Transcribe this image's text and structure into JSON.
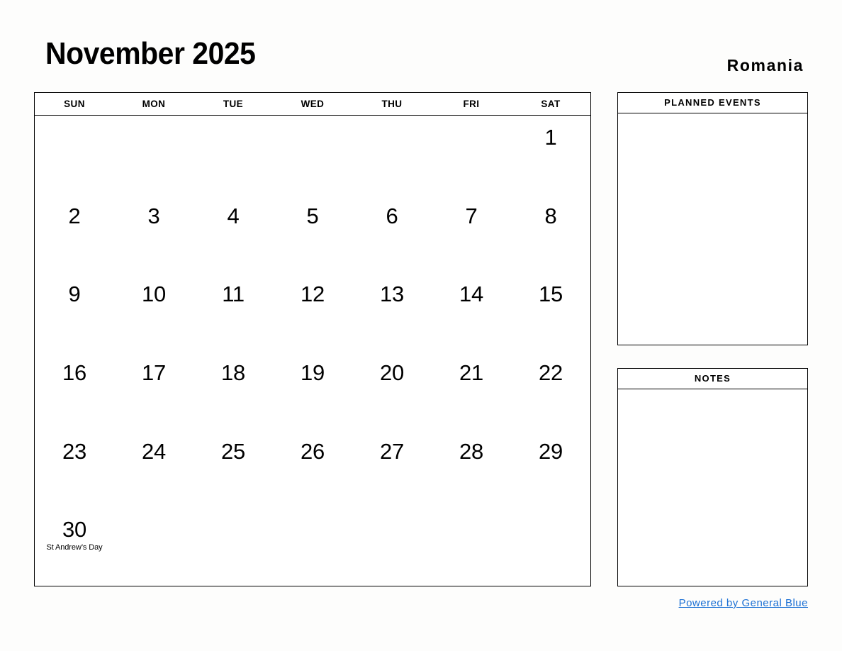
{
  "header": {
    "month_title": "November 2025",
    "country": "Romania"
  },
  "calendar": {
    "weekdays": [
      "SUN",
      "MON",
      "TUE",
      "WED",
      "THU",
      "FRI",
      "SAT"
    ],
    "weeks": [
      [
        {
          "day": "",
          "event": ""
        },
        {
          "day": "",
          "event": ""
        },
        {
          "day": "",
          "event": ""
        },
        {
          "day": "",
          "event": ""
        },
        {
          "day": "",
          "event": ""
        },
        {
          "day": "",
          "event": ""
        },
        {
          "day": "1",
          "event": ""
        }
      ],
      [
        {
          "day": "2",
          "event": ""
        },
        {
          "day": "3",
          "event": ""
        },
        {
          "day": "4",
          "event": ""
        },
        {
          "day": "5",
          "event": ""
        },
        {
          "day": "6",
          "event": ""
        },
        {
          "day": "7",
          "event": ""
        },
        {
          "day": "8",
          "event": ""
        }
      ],
      [
        {
          "day": "9",
          "event": ""
        },
        {
          "day": "10",
          "event": ""
        },
        {
          "day": "11",
          "event": ""
        },
        {
          "day": "12",
          "event": ""
        },
        {
          "day": "13",
          "event": ""
        },
        {
          "day": "14",
          "event": ""
        },
        {
          "day": "15",
          "event": ""
        }
      ],
      [
        {
          "day": "16",
          "event": ""
        },
        {
          "day": "17",
          "event": ""
        },
        {
          "day": "18",
          "event": ""
        },
        {
          "day": "19",
          "event": ""
        },
        {
          "day": "20",
          "event": ""
        },
        {
          "day": "21",
          "event": ""
        },
        {
          "day": "22",
          "event": ""
        }
      ],
      [
        {
          "day": "23",
          "event": ""
        },
        {
          "day": "24",
          "event": ""
        },
        {
          "day": "25",
          "event": ""
        },
        {
          "day": "26",
          "event": ""
        },
        {
          "day": "27",
          "event": ""
        },
        {
          "day": "28",
          "event": ""
        },
        {
          "day": "29",
          "event": ""
        }
      ],
      [
        {
          "day": "30",
          "event": "St Andrew’s Day"
        },
        {
          "day": "",
          "event": ""
        },
        {
          "day": "",
          "event": ""
        },
        {
          "day": "",
          "event": ""
        },
        {
          "day": "",
          "event": ""
        },
        {
          "day": "",
          "event": ""
        },
        {
          "day": "",
          "event": ""
        }
      ]
    ]
  },
  "panels": {
    "planned_events_title": "PLANNED EVENTS",
    "notes_title": "NOTES"
  },
  "footer": {
    "link_text": "Powered by General Blue",
    "link_color": "#1a6fd4"
  }
}
